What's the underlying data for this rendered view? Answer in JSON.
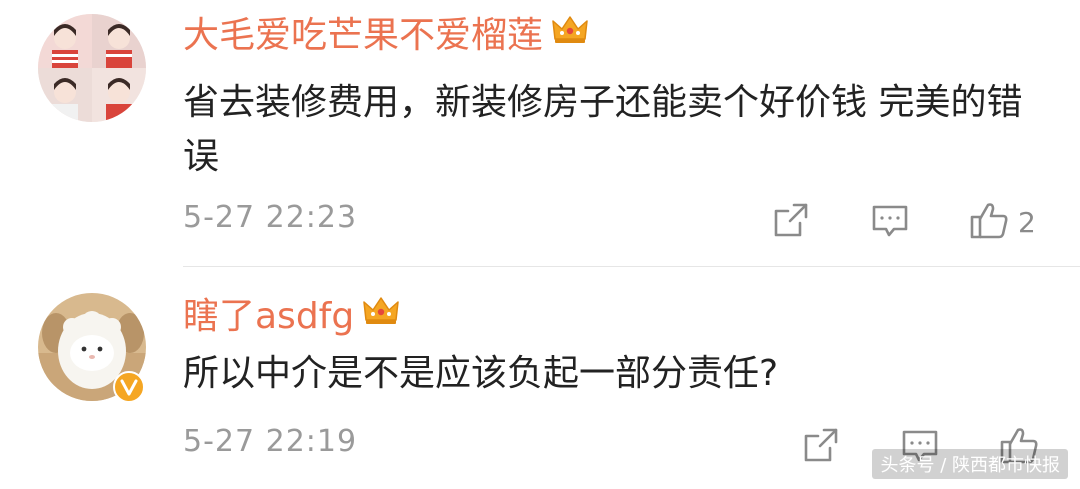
{
  "comments": [
    {
      "username": "大毛爱吃芒果不爱榴莲",
      "content": "省去装修费用，新装修房子还能卖个好价钱 完美的错误",
      "time": "5-27 22:23",
      "like_count": "2"
    },
    {
      "username": "瞎了asdfg",
      "content": "所以中介是不是应该负起一部分责任?",
      "time": "5-27 22:19",
      "like_count": ""
    }
  ],
  "watermark": "头条号 / 陕西都市快报",
  "colors": {
    "username": "#eb7350",
    "text": "#222222",
    "meta": "#9a9a9a",
    "crown": "#f5a623",
    "verified": "#f5a623"
  },
  "icons": {
    "share": "share-icon",
    "comment": "comment-icon",
    "like": "thumbs-up-icon",
    "crown": "crown-icon",
    "verified": "verified-v-icon"
  }
}
